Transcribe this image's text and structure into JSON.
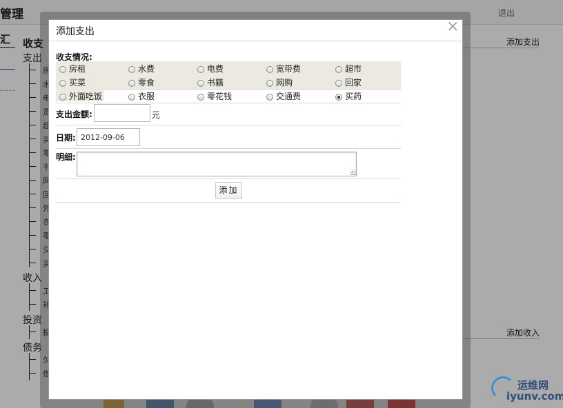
{
  "background": {
    "title": "管理",
    "logout": "退出",
    "section": "收支",
    "corner_char": "汇",
    "categories": {
      "expense": "支出",
      "income": "收入",
      "invest": "投资",
      "debt": "债务"
    },
    "expense_items": [
      "房",
      "水",
      "电",
      "宽",
      "超",
      "买",
      "零",
      "书",
      "网",
      "回",
      "外",
      "衣",
      "零",
      "交",
      "买"
    ],
    "income_items": [
      "工",
      "补"
    ],
    "invest_items": [
      "投"
    ],
    "debt_items": [
      "欠",
      "借"
    ],
    "add_expense_link": "添加支出",
    "add_income_link": "添加收入"
  },
  "watermark": {
    "top": "运维网",
    "bottom": "iyunv.com"
  },
  "dialog": {
    "title": "添加支出",
    "close_symbol": "×",
    "category_label": "收支情况:",
    "options": [
      [
        "房租",
        "水费",
        "电费",
        "宽带费",
        "超市"
      ],
      [
        "买菜",
        "零食",
        "书籍",
        "网购",
        "回家"
      ],
      [
        "外面吃饭",
        "衣服",
        "零花钱",
        "交通费",
        "买药"
      ]
    ],
    "selected_option": "买药",
    "amount_label": "支出金额:",
    "amount_value": "",
    "amount_unit": "元",
    "date_label": "日期:",
    "date_value": "2012-09-06",
    "detail_label": "明细:",
    "detail_value": "",
    "submit_label": "添加"
  }
}
